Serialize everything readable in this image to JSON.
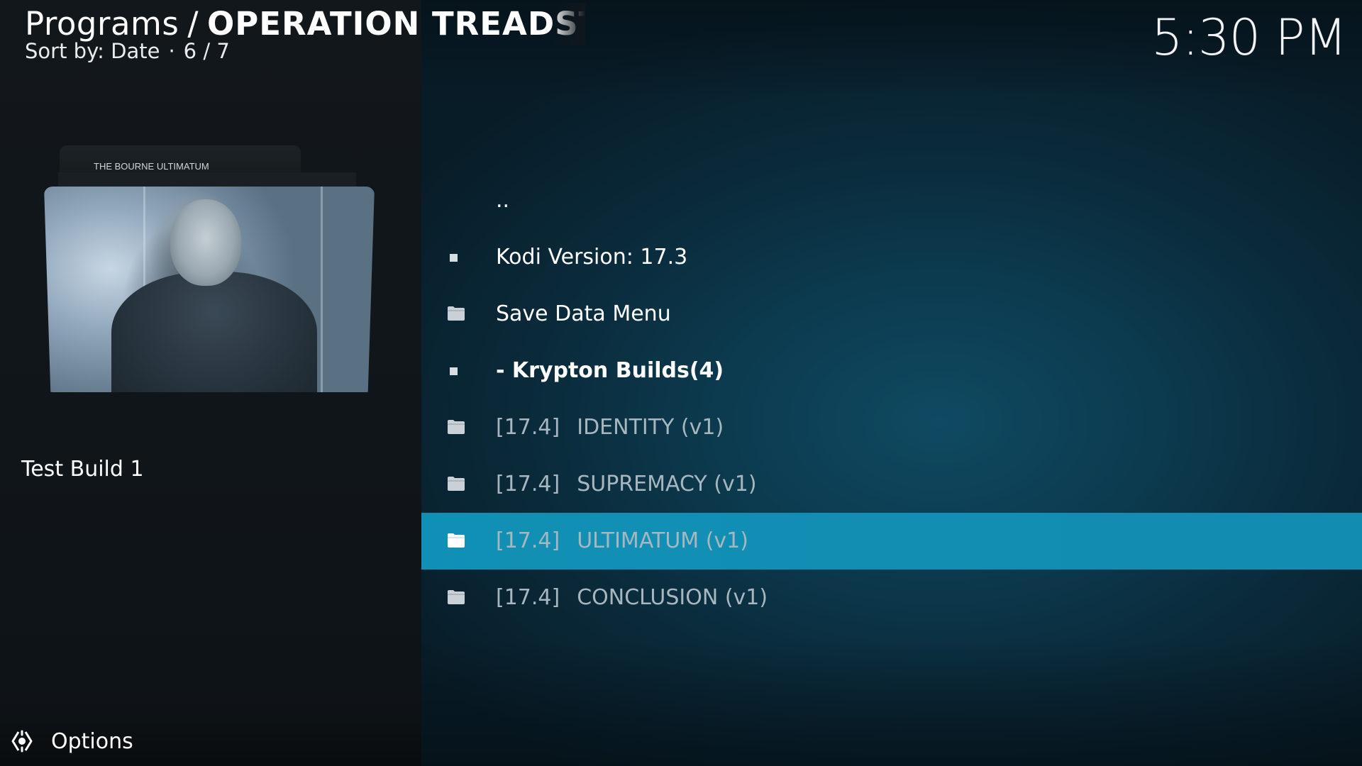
{
  "header": {
    "crumb": "Programs",
    "separator": "/",
    "current": "OPERATION TREADSTON",
    "sort_label": "Sort by: Date",
    "dot": "·",
    "position": "6 / 7"
  },
  "clock": "5:30 PM",
  "artwork": {
    "tab_label": "THE BOURNE ULTIMATUM",
    "icon": "folder-artwork"
  },
  "selected_item_title": "Test Build 1",
  "options": {
    "label": "Options",
    "icon": "options-gear-icon"
  },
  "list": {
    "items": [
      {
        "label": "..",
        "icon": "none"
      },
      {
        "label": "Kodi Version: 17.3",
        "icon": "bullet-icon"
      },
      {
        "label": "Save Data Menu",
        "icon": "folder-icon"
      },
      {
        "label": "- Krypton Builds(4)",
        "icon": "bullet-icon"
      },
      {
        "tag": "[17.4]",
        "label": "IDENTITY (v1)",
        "icon": "folder-icon"
      },
      {
        "tag": "[17.4]",
        "label": "SUPREMACY (v1)",
        "icon": "folder-icon"
      },
      {
        "tag": "[17.4]",
        "label": "ULTIMATUM (v1)",
        "icon": "folder-icon"
      },
      {
        "tag": "[17.4]",
        "label": "CONCLUSION (v1)",
        "icon": "folder-icon"
      }
    ],
    "focused_index": 6
  },
  "colors": {
    "focus": "#1190b5",
    "panel_left": "#12171b",
    "panel_right": "#0c3a4e",
    "dim_text": "#a7b6bf"
  }
}
